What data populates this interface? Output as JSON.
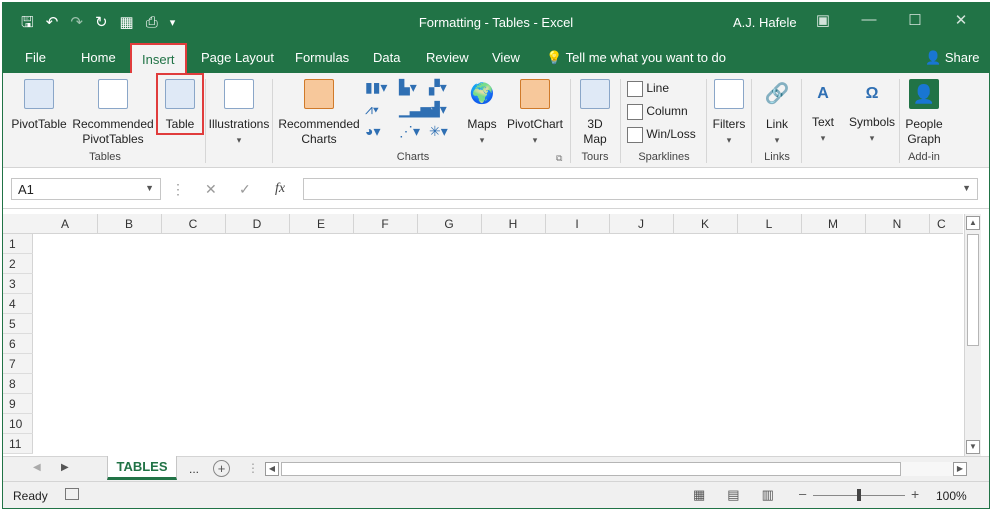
{
  "titlebar": {
    "title": "Formatting - Tables  -  Excel",
    "user": "A.J. Hafele"
  },
  "qat": {
    "save_icon": "save-icon",
    "undo_icon": "undo-icon",
    "redo_icon": "redo-icon",
    "refresh_icon": "refresh-icon",
    "form_icon": "form-icon",
    "preview_icon": "print-preview-icon",
    "customize_icon": "customize-icon"
  },
  "tabs": {
    "file": "File",
    "home": "Home",
    "insert": "Insert",
    "page_layout": "Page Layout",
    "formulas": "Formulas",
    "data": "Data",
    "review": "Review",
    "view": "View",
    "tellme": "Tell me what you want to do",
    "share": "Share"
  },
  "ribbon": {
    "pivottable": "PivotTable",
    "recommended_pivottables_1": "Recommended",
    "recommended_pivottables_2": "PivotTables",
    "table": "Table",
    "group_tables": "Tables",
    "illustrations": "Illustrations",
    "recommended_charts_1": "Recommended",
    "recommended_charts_2": "Charts",
    "maps": "Maps",
    "pivotchart": "PivotChart",
    "map3d_1": "3D",
    "map3d_2": "Map",
    "group_charts": "Charts",
    "group_tours": "Tours",
    "sparkline_line": "Line",
    "sparkline_column": "Column",
    "sparkline_winloss": "Win/Loss",
    "group_sparklines": "Sparklines",
    "filters": "Filters",
    "link": "Link",
    "group_links": "Links",
    "text": "Text",
    "symbols": "Symbols",
    "people_graph_1": "People",
    "people_graph_2": "Graph",
    "group_addin": "Add-in"
  },
  "formula_bar": {
    "name_box": "A1",
    "cancel_symbol": "✕",
    "enter_symbol": "✓",
    "fx_symbol": "fx",
    "value": ""
  },
  "grid": {
    "columns": [
      "A",
      "B",
      "C",
      "D",
      "E",
      "F",
      "G",
      "H",
      "I",
      "J",
      "K",
      "L",
      "M",
      "N"
    ],
    "partial_column": "C",
    "rows": [
      "1",
      "2",
      "3",
      "4",
      "5",
      "6",
      "7",
      "8",
      "9",
      "10",
      "11"
    ]
  },
  "sheets": {
    "active": "TABLES",
    "ellipsis": "...",
    "add": "+"
  },
  "status": {
    "ready": "Ready",
    "zoom": "100%",
    "zoom_level": 1.0
  },
  "colors": {
    "brand": "#217346",
    "highlight": "#e03c3c"
  }
}
